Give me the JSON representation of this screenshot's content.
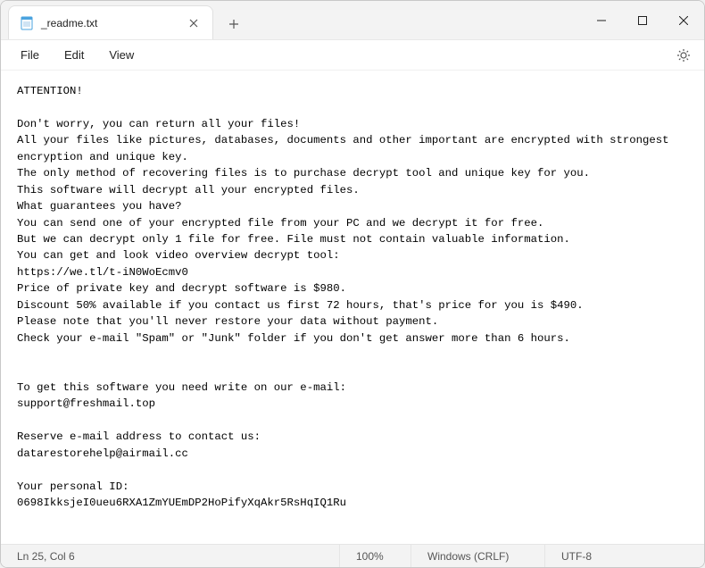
{
  "tab": {
    "title": "_readme.txt"
  },
  "menu": {
    "file": "File",
    "edit": "Edit",
    "view": "View"
  },
  "content": {
    "text": "ATTENTION!\n\nDon't worry, you can return all your files!\nAll your files like pictures, databases, documents and other important are encrypted with strongest encryption and unique key.\nThe only method of recovering files is to purchase decrypt tool and unique key for you.\nThis software will decrypt all your encrypted files.\nWhat guarantees you have?\nYou can send one of your encrypted file from your PC and we decrypt it for free.\nBut we can decrypt only 1 file for free. File must not contain valuable information.\nYou can get and look video overview decrypt tool:\nhttps://we.tl/t-iN0WoEcmv0\nPrice of private key and decrypt software is $980.\nDiscount 50% available if you contact us first 72 hours, that's price for you is $490.\nPlease note that you'll never restore your data without payment.\nCheck your e-mail \"Spam\" or \"Junk\" folder if you don't get answer more than 6 hours.\n\n\nTo get this software you need write on our e-mail:\nsupport@freshmail.top\n\nReserve e-mail address to contact us:\ndatarestorehelp@airmail.cc\n\nYour personal ID:\n0698IkksjeI0ueu6RXA1ZmYUEmDP2HoPifyXqAkr5RsHqIQ1Ru"
  },
  "status": {
    "position": "Ln 25, Col 6",
    "zoom": "100%",
    "eol": "Windows (CRLF)",
    "encoding": "UTF-8"
  }
}
